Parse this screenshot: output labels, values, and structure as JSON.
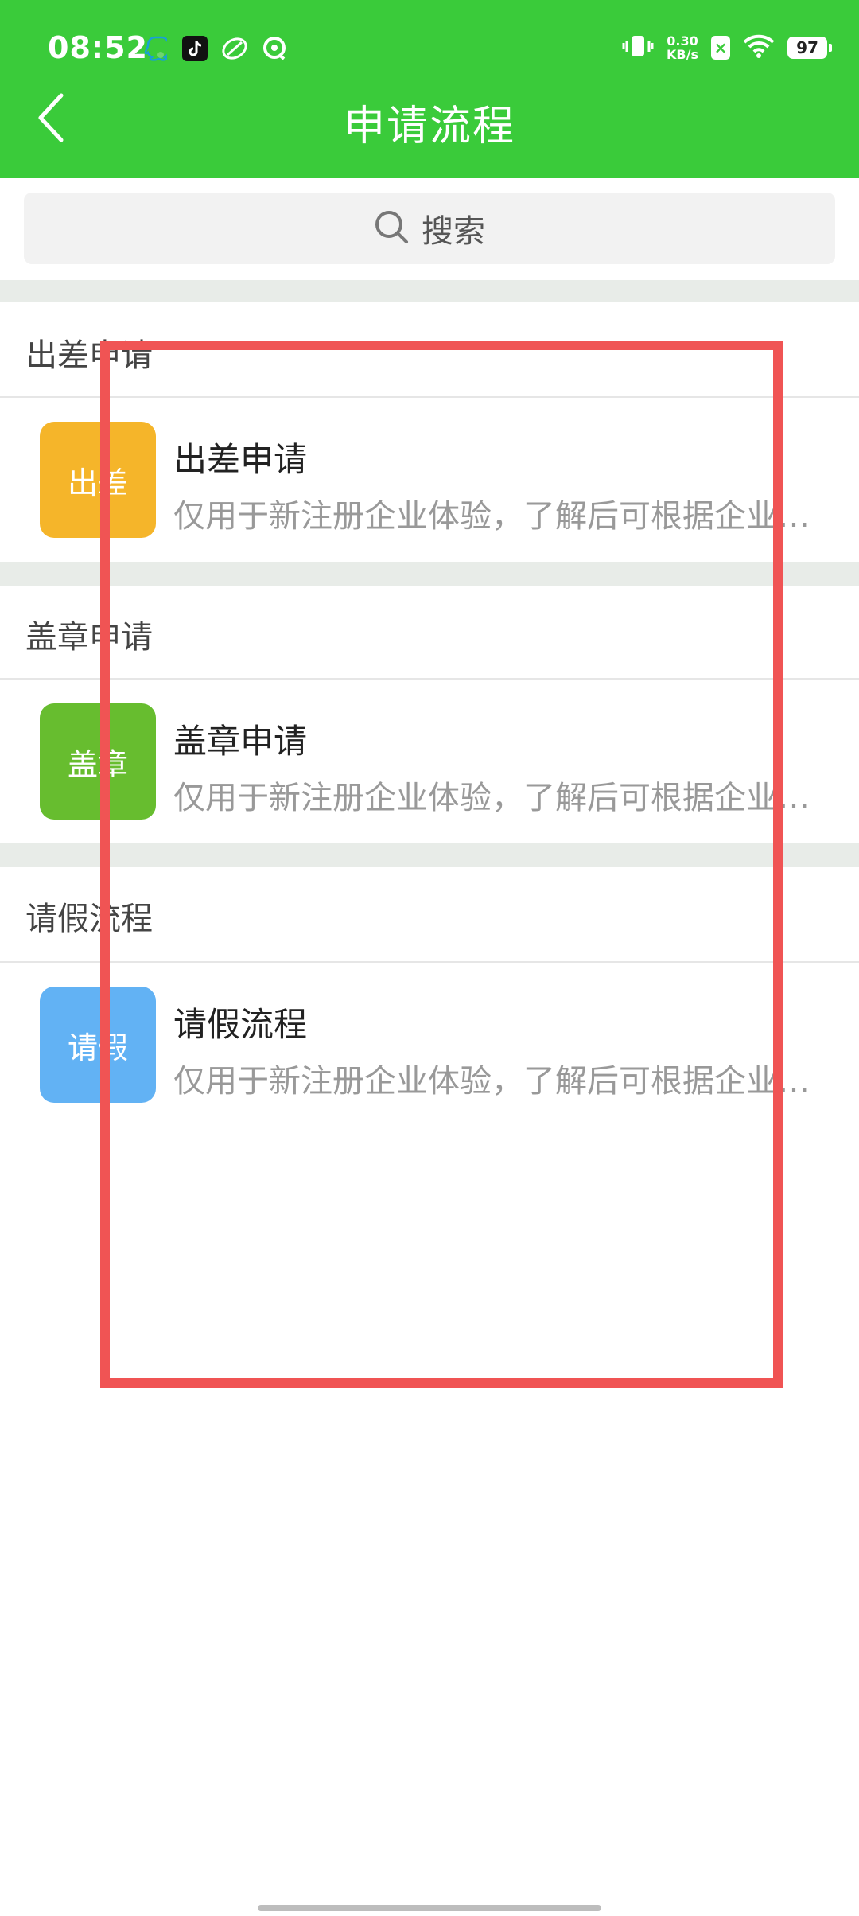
{
  "status_bar": {
    "time": "08:52",
    "net_speed_value": "0.30",
    "net_speed_unit": "KB/s",
    "sim_mark": "×",
    "battery": "97",
    "icons": [
      "qq-icon",
      "tiktok-icon",
      "leaf-icon",
      "chat-icon",
      "vibrate-icon",
      "wifi-icon"
    ]
  },
  "header": {
    "title": "申请流程",
    "back_icon": "chevron-left-icon"
  },
  "search": {
    "placeholder": "搜索",
    "icon": "search-icon"
  },
  "sections": [
    {
      "title": "出差申请",
      "items": [
        {
          "icon_text": "出差",
          "icon_color": "#f5b52a",
          "title": "出差申请",
          "desc": "仅用于新注册企业体验，了解后可根据企业需要修改"
        }
      ]
    },
    {
      "title": "盖章申请",
      "items": [
        {
          "icon_text": "盖章",
          "icon_color": "#67bd2f",
          "title": "盖章申请",
          "desc": "仅用于新注册企业体验，了解后可根据企业需要修改"
        }
      ]
    },
    {
      "title": "请假流程",
      "items": [
        {
          "icon_text": "请假",
          "icon_color": "#62b2f4",
          "title": "请假流程",
          "desc": "仅用于新注册企业体验，了解后可根据企业需要修改"
        }
      ]
    }
  ],
  "colors": {
    "header_bg": "#3acb3a",
    "highlight_border": "#f05454"
  }
}
